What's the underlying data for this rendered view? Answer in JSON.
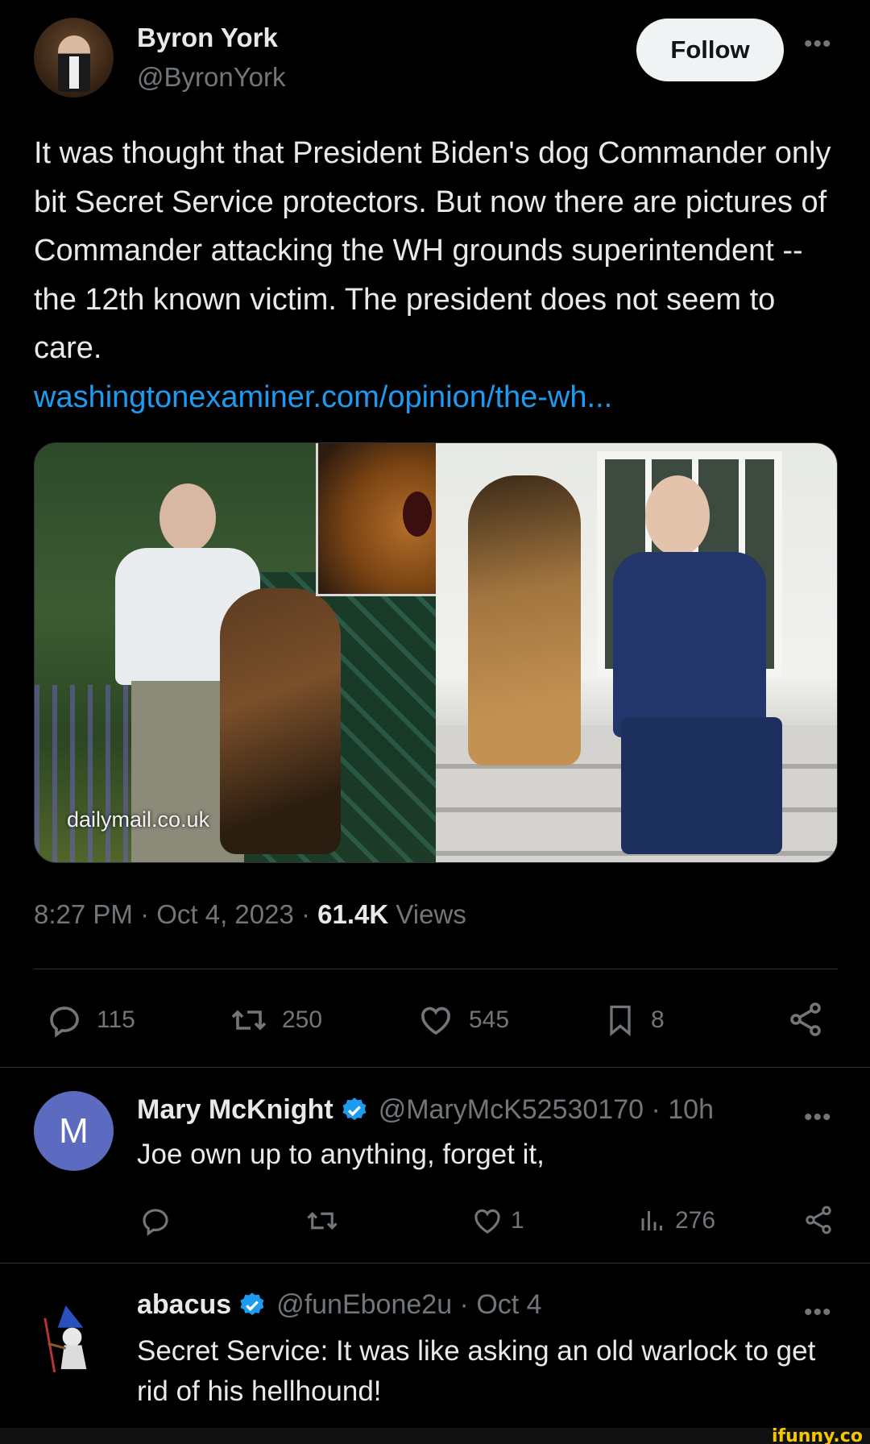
{
  "author": {
    "name": "Byron York",
    "handle": "@ByronYork",
    "follow_label": "Follow"
  },
  "tweet": {
    "text": "It was thought that President Biden's dog Commander only bit Secret Service protectors. But now there are pictures of Commander attacking the WH grounds superintendent -- the 12th known victim. The president does not seem to care.",
    "link": "washingtonexaminer.com/opinion/the-wh...",
    "media_watermark": "dailymail.co.uk",
    "time": "8:27 PM · Oct 4, 2023 · ",
    "views_count": "61.4K",
    "views_label": " Views"
  },
  "stats": {
    "replies": "115",
    "retweets": "250",
    "likes": "545",
    "bookmarks": "8"
  },
  "replies": [
    {
      "avatar_letter": "M",
      "avatar_color": "#5c6bc0",
      "name": "Mary McKnight",
      "handle_time": "@MaryMcK52530170 · 10h",
      "text": "Joe own up to anything, forget it,",
      "likes": "1",
      "views": "276"
    },
    {
      "name": "abacus",
      "handle_time": "@funEbone2u · Oct 4",
      "text": "Secret Service: It was like asking an old warlock to get rid of his hellhound!"
    }
  ],
  "footer": {
    "watermark": "ifunny.co"
  },
  "colors": {
    "background": "#000000",
    "text": "#e7e9ea",
    "muted": "#71767b",
    "link": "#1d9bf0",
    "verified": "#1d9bf0"
  },
  "icons": [
    "more-icon",
    "reply-icon",
    "retweet-icon",
    "like-icon",
    "bookmark-icon",
    "share-icon",
    "views-icon",
    "verified-icon"
  ]
}
